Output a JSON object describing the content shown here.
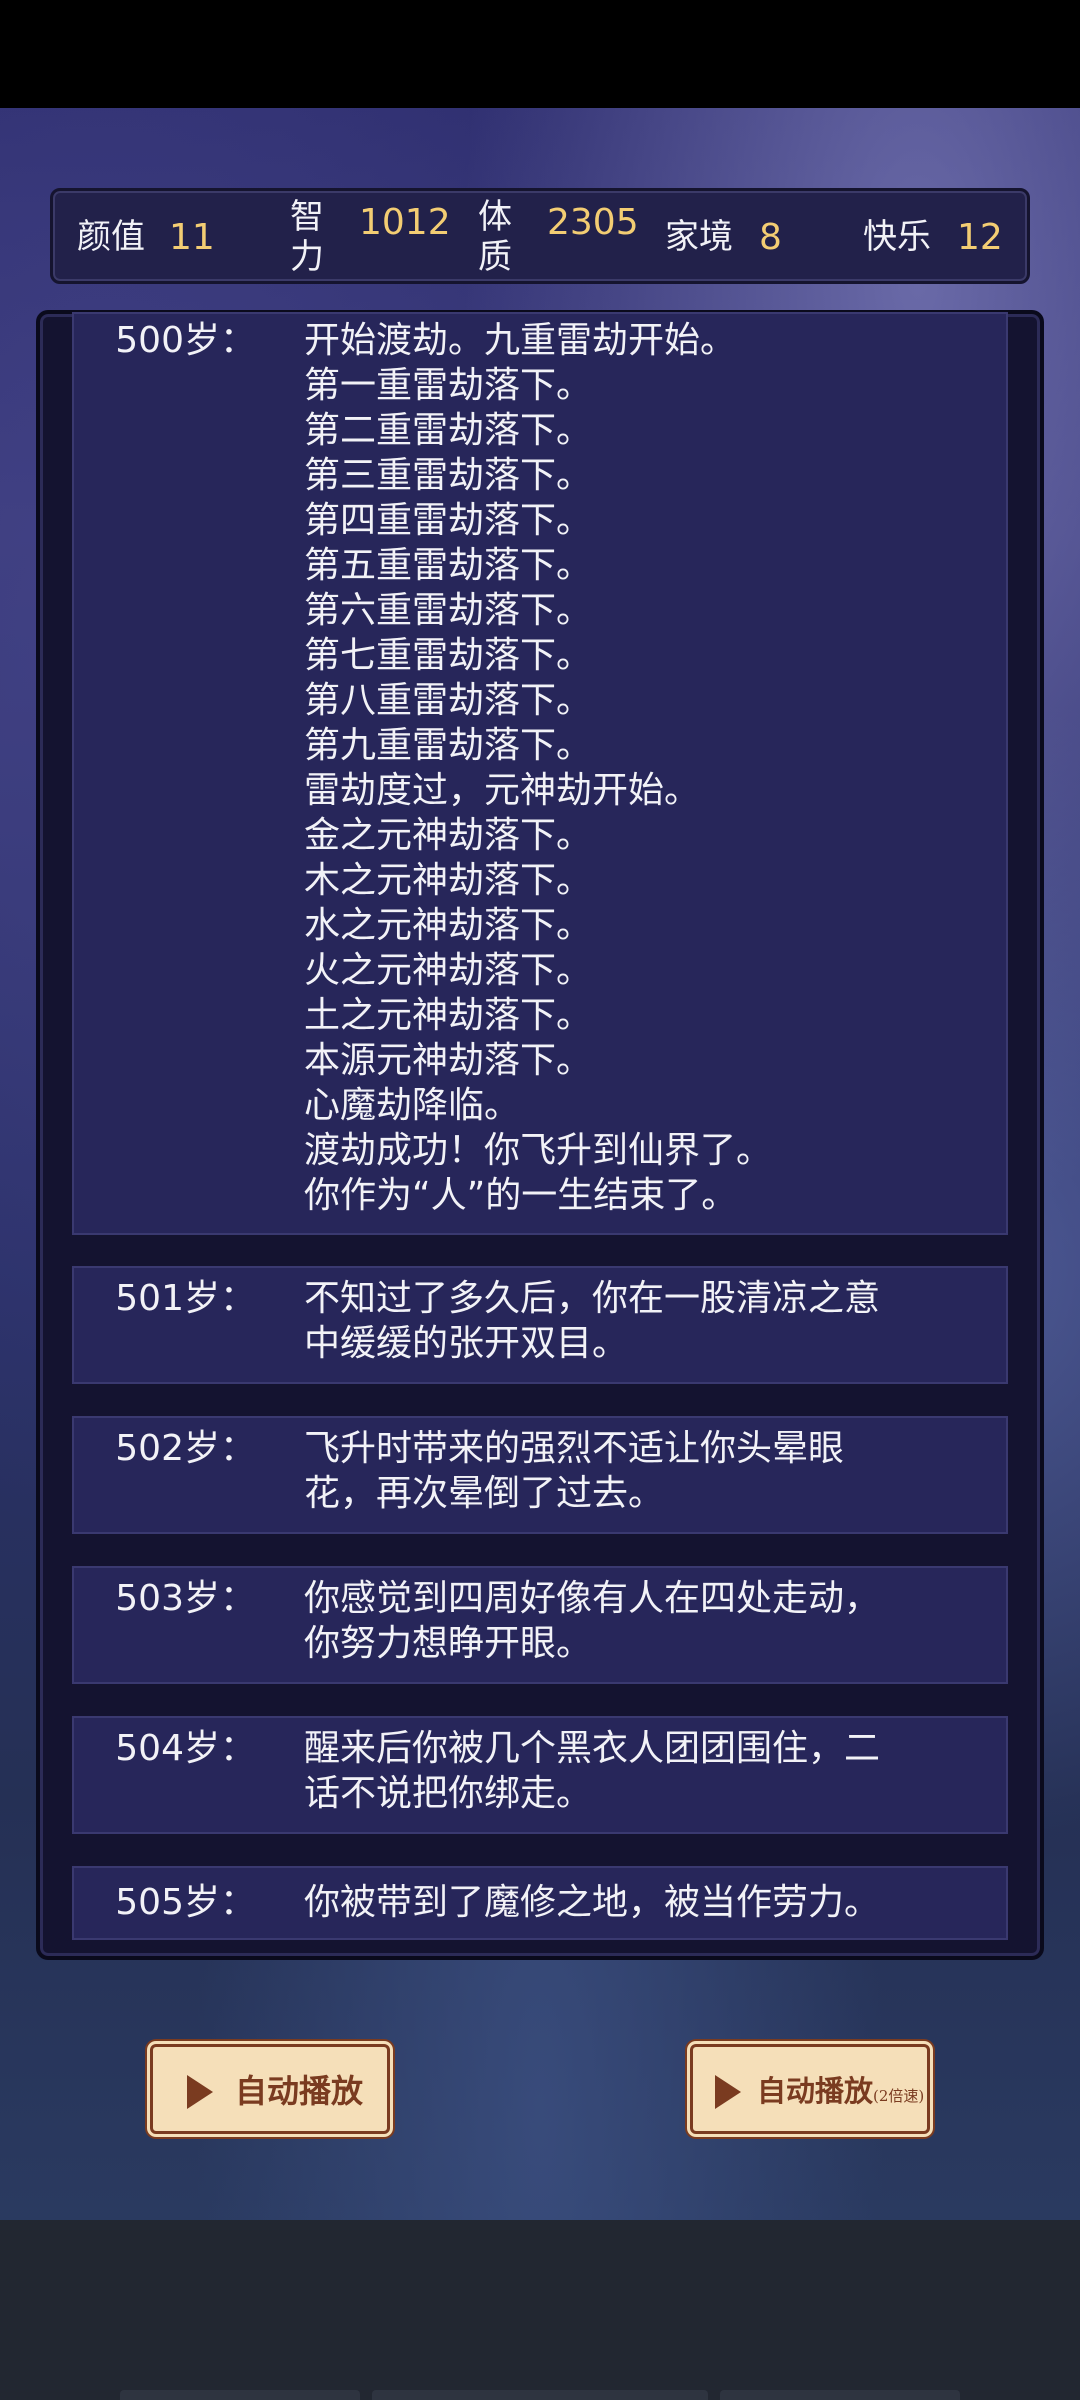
{
  "stats": [
    {
      "key": "looks",
      "label": "颜值",
      "value": "11"
    },
    {
      "key": "intelligence",
      "label": "智力",
      "value": "1012"
    },
    {
      "key": "physique",
      "label": "体质",
      "value": "2305"
    },
    {
      "key": "family",
      "label": "家境",
      "value": "8"
    },
    {
      "key": "happiness",
      "label": "快乐",
      "value": "12"
    }
  ],
  "log": [
    {
      "age": "500岁：",
      "text": "开始渡劫。九重雷劫开始。\n第一重雷劫落下。\n第二重雷劫落下。\n第三重雷劫落下。\n第四重雷劫落下。\n第五重雷劫落下。\n第六重雷劫落下。\n第七重雷劫落下。\n第八重雷劫落下。\n第九重雷劫落下。\n雷劫度过，元神劫开始。\n金之元神劫落下。\n木之元神劫落下。\n水之元神劫落下。\n火之元神劫落下。\n土之元神劫落下。\n本源元神劫落下。\n心魔劫降临。\n渡劫成功！你飞升到仙界了。\n你作为“人”的一生结束了。"
    },
    {
      "age": "501岁：",
      "text": "不知过了多久后，你在一股清凉之意\n中缓缓的张开双目。"
    },
    {
      "age": "502岁：",
      "text": "飞升时带来的强烈不适让你头晕眼\n花，再次晕倒了过去。"
    },
    {
      "age": "503岁：",
      "text": "你感觉到四周好像有人在四处走动，\n你努力想睁开眼。"
    },
    {
      "age": "504岁：",
      "text": "醒来后你被几个黑衣人团团围住，二\n话不说把你绑走。"
    },
    {
      "age": "505岁：",
      "text": "你被带到了魔修之地，被当作劳力。"
    }
  ],
  "buttons": {
    "auto_play": "自动播放",
    "auto_play_fast": "自动播放",
    "auto_play_fast_suffix": "(2倍速)"
  },
  "icons": {
    "play": "play-triangle-icon"
  }
}
